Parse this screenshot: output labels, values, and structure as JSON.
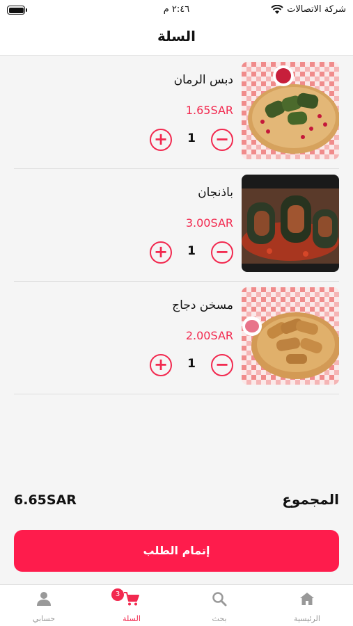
{
  "status_bar": {
    "carrier": "شركة الاتصالات",
    "time": "٢:٤٦ م"
  },
  "header": {
    "title": "السلة"
  },
  "cart_items": [
    {
      "name": "دبس الرمان",
      "price": "1.65SAR",
      "quantity": "1",
      "image": "grape-leaves-pomegranate"
    },
    {
      "name": "باذنجان",
      "price": "3.00SAR",
      "quantity": "1",
      "image": "stuffed-eggplant"
    },
    {
      "name": "مسخن دجاج",
      "price": "2.00SAR",
      "quantity": "1",
      "image": "musakhan-rolls"
    }
  ],
  "summary": {
    "total_label": "المجموع",
    "total_value": "6.65SAR"
  },
  "checkout": {
    "label": "إتمام الطلب"
  },
  "tabbar": {
    "tabs": [
      {
        "label": "الرئيسية",
        "icon": "home-icon"
      },
      {
        "label": "بحث",
        "icon": "search-icon"
      },
      {
        "label": "السلة",
        "icon": "cart-icon",
        "badge": "3",
        "active": true
      },
      {
        "label": "حسابي",
        "icon": "person-icon"
      }
    ]
  },
  "colors": {
    "accent": "#f2294f",
    "button": "#fe1c4c",
    "inactive": "#999999"
  }
}
